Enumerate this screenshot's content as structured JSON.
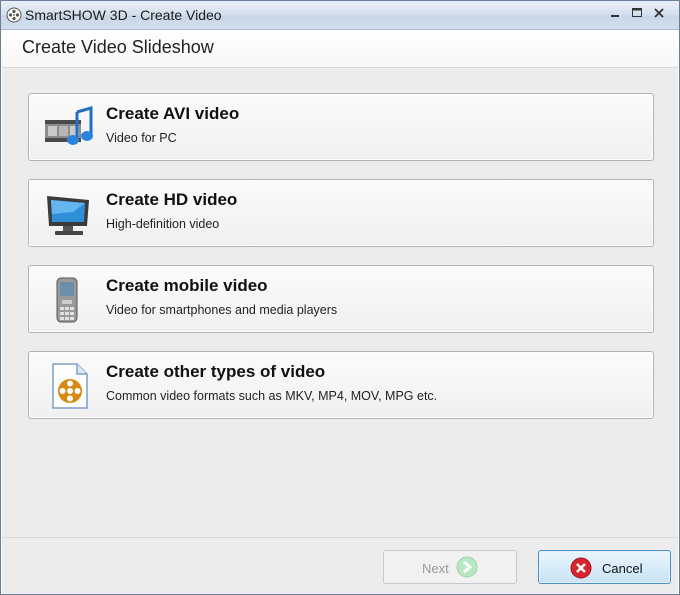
{
  "window": {
    "title": "SmartSHOW 3D - Create Video",
    "app_icon": "film-reel-icon",
    "controls": [
      "minimize",
      "maximize",
      "close"
    ]
  },
  "header": {
    "title": "Create Video Slideshow"
  },
  "options": [
    {
      "title": "Create AVI video",
      "description": "Video for PC",
      "icon": "film-music-icon"
    },
    {
      "title": "Create HD video",
      "description": "High-definition video",
      "icon": "monitor-icon"
    },
    {
      "title": "Create mobile video",
      "description": "Video for smartphones and media players",
      "icon": "mobile-phone-icon"
    },
    {
      "title": "Create other types of video",
      "description": "Common video formats such as MKV, MP4, MOV, MPG etc.",
      "icon": "video-file-icon"
    }
  ],
  "footer": {
    "next_label": "Next",
    "cancel_label": "Cancel"
  },
  "colors": {
    "titlebar": "#d6e1ef",
    "content_bg": "#ececec",
    "cancel_border": "#4d8fc9",
    "next_arrow": "#8fd8a0",
    "cancel_icon": "#d9232e"
  }
}
